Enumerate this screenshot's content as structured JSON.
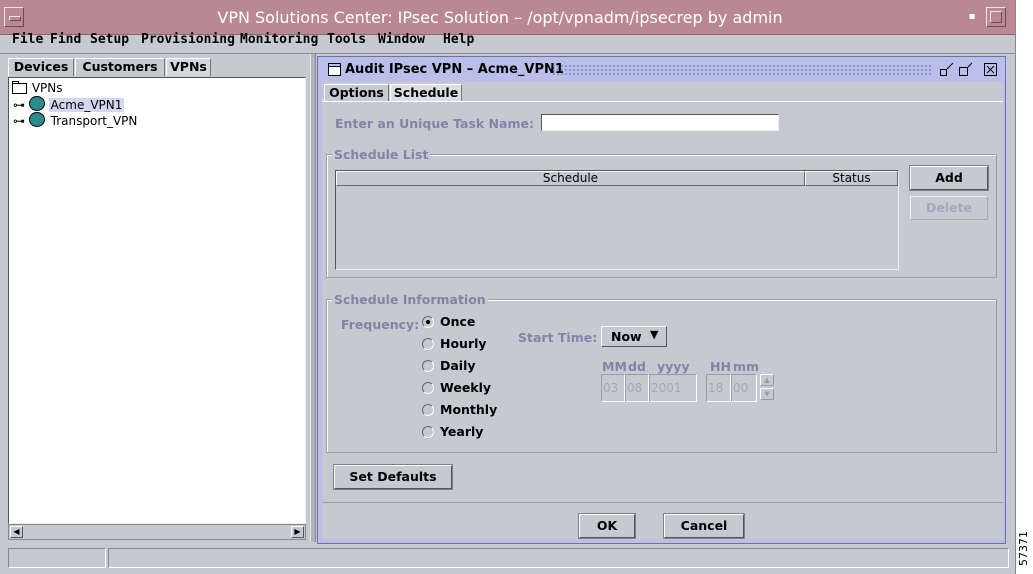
{
  "window": {
    "title": "VPN Solutions Center: IPsec Solution – /opt/vpnadm/ipsecrep by admin"
  },
  "menu": [
    {
      "label": "File"
    },
    {
      "label": "Find"
    },
    {
      "label": "Setup"
    },
    {
      "label": "Provisioning"
    },
    {
      "label": "Monitoring"
    },
    {
      "label": "Tools"
    },
    {
      "label": "Window"
    },
    {
      "label": "Help"
    }
  ],
  "left_tabs": [
    {
      "label": "Devices"
    },
    {
      "label": "Customers"
    },
    {
      "label": "VPNs"
    }
  ],
  "tree": {
    "root": "VPNs",
    "items": [
      {
        "label": "Acme_VPN1"
      },
      {
        "label": "Transport_VPN"
      }
    ]
  },
  "dialog": {
    "title": "Audit IPsec VPN – Acme_VPN1",
    "tabs": [
      {
        "label": "Options"
      },
      {
        "label": "Schedule"
      }
    ],
    "task_name_label": "Enter an Unique Task Name:",
    "task_name_value": "",
    "schedule_list": {
      "title": "Schedule List",
      "columns": [
        "Schedule",
        "Status"
      ],
      "add_label": "Add",
      "delete_label": "Delete"
    },
    "schedule_info": {
      "title": "Schedule Information",
      "frequency_label": "Frequency:",
      "frequencies": [
        "Once",
        "Hourly",
        "Daily",
        "Weekly",
        "Monthly",
        "Yearly"
      ],
      "selected_frequency": "Once",
      "start_time_label": "Start Time:",
      "start_time_value": "Now",
      "date_labels": {
        "mm": "MM",
        "dd": "dd",
        "yyyy": "yyyy",
        "hh": "HH",
        "min": "mm"
      },
      "date_values": {
        "mm": "03",
        "dd": "08",
        "yyyy": "2001",
        "hh": "18",
        "min": "00"
      }
    },
    "set_defaults_label": "Set Defaults",
    "ok_label": "OK",
    "cancel_label": "Cancel"
  },
  "figure_id": "57371"
}
